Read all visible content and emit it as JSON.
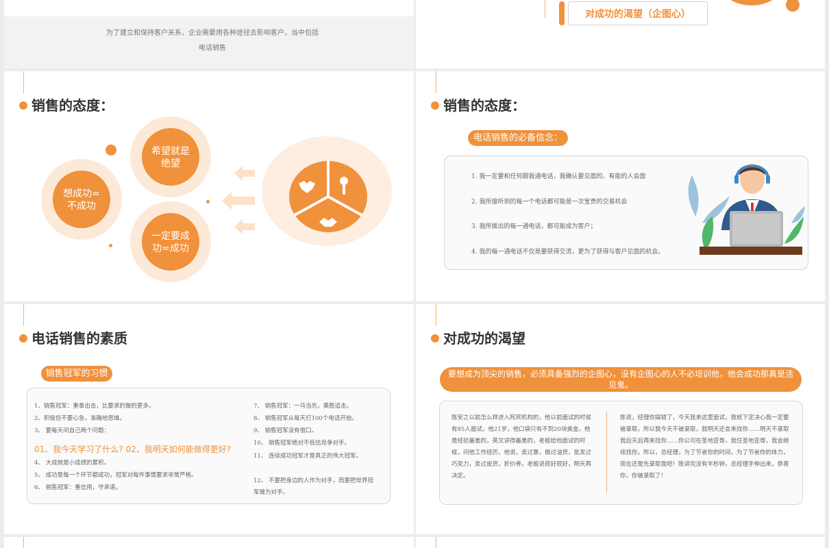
{
  "slide_top_left": {
    "caption": "为了建立和保持客户关系，企业需要用各种途径去影响客户，当中包括电话销售"
  },
  "slide_top_right": {
    "label": "对成功的渴望（企图心）"
  },
  "attitude_left": {
    "title": "销售的态度：",
    "circles": {
      "left": "想成功=\n不成功",
      "top": "希望就是\n绝望",
      "bottom": "一定要成\n功=成功"
    }
  },
  "attitude_right": {
    "title": "销售的态度：",
    "pill": "电话销售的必备信念：",
    "beliefs": [
      "1. 我一定要和任何跟我通电话，我确认要见面的、有能的人会面",
      "2. 我所接听到的每一个电话都可能是一次宝贵的交易机会",
      "3. 我所拨出的每一通电话，都可能成为客户；",
      "4. 我的每一通电话不仅是要获得交流，更为了获得与客户见面的机会。"
    ]
  },
  "quality": {
    "title": "电话销售的素质",
    "pill": "销售冠军的习惯",
    "left_top": [
      "1、销售冠军：重拳出击，比要求的做的更多。",
      "2、积极但不要心急，准确地思维。",
      "3、  要每天问自己两个问题："
    ],
    "highlight": "01、我今天学习了什么? 02、我明天如何能做得更好?",
    "left_bottom": [
      "4、  大成就是小成绩的累积。",
      "5、  成功是每一个环节都成功，冠军对每件事情要求非常严格。",
      "6、  销售冠军：重信用，守承诺。"
    ],
    "right": [
      "7、  销售冠军：一马当先，乘胜追击。",
      "8、  销售冠军从每天打100个电话开始。",
      "9、  销售冠军没有借口。",
      "10、  销售冠军绝对不低估竞争对手。",
      "11、  连续成功冠军才是真正的伟大冠军。",
      "12、  不要把身边的人作为对手，而要把世界冠军做为对手。"
    ]
  },
  "desire": {
    "title": "对成功的渴望",
    "banner": "要想成为顶尖的销售，必须具备强烈的企图心，没有企图心的人不必培训他，他会成功那真是活见鬼。",
    "left_text": "陈安之以前怎么样进入阿宾机构的，他以前面试的时候有85人面试，他21岁，他口袋只有不到20块美金，他是经验最差的，英文讲得最差的，老板给他面试的时候，问他工作经历，他说，卖过寨，做过油货，批发过巧克力，卖过皮货，折价券，老板说很好很好，明天再决定。",
    "right_text": "陈说，经理你搞错了，今天我来这里面试，我就下定决心我一定要被录取，所以我今天不被录取，我明天还会来找你……明天不录取我后天后再来找你……你公司在圣地亚哥，我住圣地亚哥，我会继续找你，所以，总经理，为了节省你的时间，为了节省你的体力，现在还是先录取我吧！陈讲完没有半秒钟，总经理手伸出来，恭喜你，你被录取了！"
  },
  "colors": {
    "accent": "#f0913b",
    "light": "#fde6d2",
    "text": "#666666"
  }
}
